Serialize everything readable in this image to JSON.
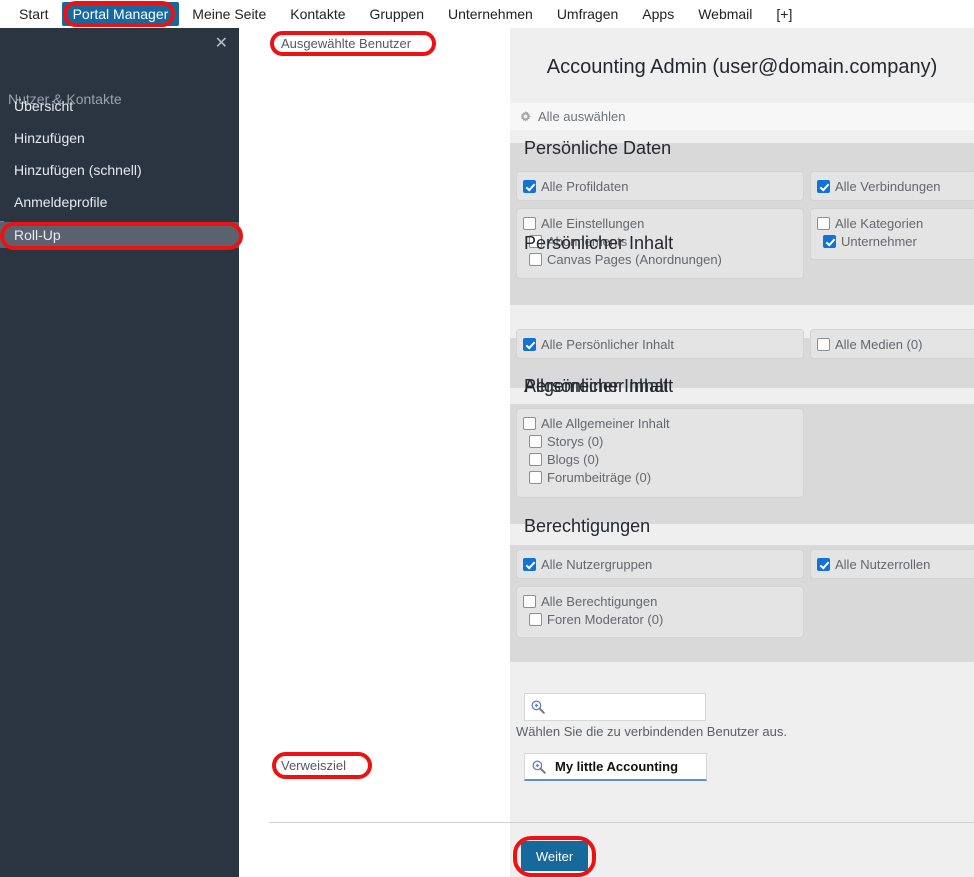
{
  "topnav": {
    "items": [
      {
        "label": "Start",
        "active": false
      },
      {
        "label": "Portal Manager",
        "active": true
      },
      {
        "label": "Meine Seite",
        "active": false
      },
      {
        "label": "Kontakte",
        "active": false
      },
      {
        "label": "Gruppen",
        "active": false
      },
      {
        "label": "Unternehmen",
        "active": false
      },
      {
        "label": "Umfragen",
        "active": false
      },
      {
        "label": "Apps",
        "active": false
      },
      {
        "label": "Webmail",
        "active": false
      },
      {
        "label": "[+]",
        "active": false
      }
    ]
  },
  "sidebar": {
    "close_icon": "close-icon",
    "close_glyph": "✕",
    "heading": "Nutzer & Kontakte",
    "items": [
      {
        "label": "Übersicht",
        "selected": false
      },
      {
        "label": "Hinzufügen",
        "selected": false
      },
      {
        "label": "Hinzufügen (schnell)",
        "selected": false
      },
      {
        "label": "Anmeldeprofile",
        "selected": false
      },
      {
        "label": "Roll-Up",
        "selected": true
      }
    ],
    "background_color": "#2b3542",
    "selected_color": "#5a6270",
    "accent_color": "#2e9ad0"
  },
  "labels": {
    "selected_users": "Ausgewählte Benutzer",
    "reference_target": "Verweisziel"
  },
  "main": {
    "user_title": "Accounting Admin (user@domain.company)",
    "select_all": "Alle auswählen",
    "select_all_icon": "gear-icon",
    "sections": [
      {
        "title": "Persönliche Daten",
        "left": [
          {
            "box": [
              {
                "label": "Alle Profildaten",
                "checked": true,
                "indent": false
              }
            ]
          },
          {
            "box": [
              {
                "label": "Alle Einstellungen",
                "checked": false,
                "indent": false
              },
              {
                "label": "Abonnements",
                "checked": false,
                "indent": true
              },
              {
                "label": "Canvas Pages (Anordnungen)",
                "checked": false,
                "indent": true
              }
            ]
          }
        ],
        "right": [
          {
            "box": [
              {
                "label": "Alle Verbindungen",
                "checked": true,
                "indent": false
              }
            ]
          },
          {
            "box": [
              {
                "label": "Alle Kategorien",
                "checked": false,
                "indent": false
              },
              {
                "label": "Unternehmer",
                "checked": true,
                "indent": true
              }
            ]
          }
        ]
      },
      {
        "title": "Persönlicher Inhalt",
        "left": [
          {
            "box": [
              {
                "label": "Alle Persönlicher Inhalt",
                "checked": true,
                "indent": false
              }
            ]
          }
        ],
        "right": [
          {
            "box": [
              {
                "label": "Alle Medien (0)",
                "checked": false,
                "indent": false
              }
            ]
          }
        ]
      },
      {
        "title": "Allgemeiner Inhalt",
        "left": [
          {
            "box": [
              {
                "label": "Alle Allgemeiner Inhalt",
                "checked": false,
                "indent": false
              },
              {
                "label": "Storys (0)",
                "checked": false,
                "indent": true
              },
              {
                "label": "Blogs (0)",
                "checked": false,
                "indent": true
              },
              {
                "label": "Forumbeiträge (0)",
                "checked": false,
                "indent": true
              }
            ]
          }
        ],
        "right": []
      },
      {
        "title": "Berechtigungen",
        "left": [
          {
            "box": [
              {
                "label": "Alle Nutzergruppen",
                "checked": true,
                "indent": false
              }
            ]
          },
          {
            "box": [
              {
                "label": "Alle Berechtigungen",
                "checked": false,
                "indent": false
              },
              {
                "label": "Foren Moderator (0)",
                "checked": false,
                "indent": true
              }
            ]
          }
        ],
        "right": [
          {
            "box": [
              {
                "label": "Alle Nutzerrollen",
                "checked": true,
                "indent": false
              }
            ]
          }
        ]
      }
    ],
    "search": {
      "value": "",
      "placeholder": "",
      "icon": "search-plus-icon",
      "help_text": "Wählen Sie die zu verbindenden Benutzer aus."
    },
    "reference": {
      "value": "My little Accounting  ",
      "icon": "search-plus-icon"
    },
    "submit_label": "Weiter",
    "accent_color": "#17699c",
    "checkbox_color": "#1172d8"
  }
}
